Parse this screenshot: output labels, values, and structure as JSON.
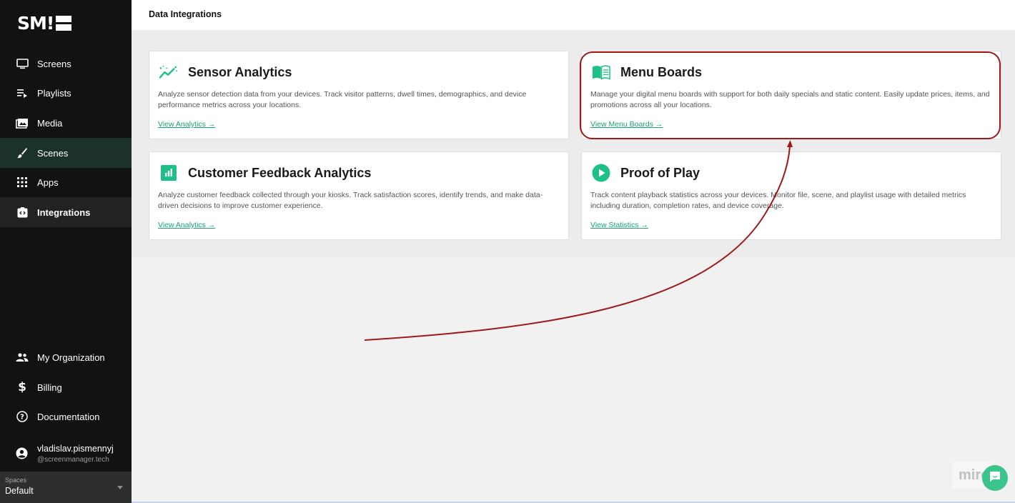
{
  "brand": {
    "logo_text": "SM!"
  },
  "sidebar": {
    "items": [
      {
        "label": "Screens",
        "icon": "monitor-icon"
      },
      {
        "label": "Playlists",
        "icon": "playlist-icon"
      },
      {
        "label": "Media",
        "icon": "media-icon"
      },
      {
        "label": "Scenes",
        "icon": "brush-icon"
      },
      {
        "label": "Apps",
        "icon": "apps-grid-icon"
      },
      {
        "label": "Integrations",
        "icon": "integrations-icon"
      }
    ],
    "bottom_items": [
      {
        "label": "My Organization",
        "icon": "people-icon"
      },
      {
        "label": "Billing",
        "icon": "dollar-icon"
      },
      {
        "label": "Documentation",
        "icon": "help-circle-icon"
      }
    ],
    "user": {
      "name": "vladislav.pismennyj",
      "email": "@screenmanager.tech"
    },
    "spaces": {
      "label": "Spaces",
      "value": "Default"
    }
  },
  "header": {
    "title": "Data Integrations"
  },
  "cards": [
    {
      "title": "Sensor Analytics",
      "description": "Analyze sensor detection data from your devices. Track visitor patterns, dwell times, demographics, and device performance metrics across your locations.",
      "link": "View Analytics →"
    },
    {
      "title": "Menu Boards",
      "description": "Manage your digital menu boards with support for both daily specials and static content. Easily update prices, items, and promotions across all your locations.",
      "link": "View Menu Boards →"
    },
    {
      "title": "Customer Feedback Analytics",
      "description": "Analyze customer feedback collected through your kiosks. Track satisfaction scores, identify trends, and make data-driven decisions to improve customer experience.",
      "link": "View Analytics →"
    },
    {
      "title": "Proof of Play",
      "description": "Track content playback statistics across your devices. Monitor file, scene, and playlist usage with detailed metrics including duration, completion rates, and device coverage.",
      "link": "View Statistics →"
    }
  ],
  "overlay": {
    "watermark": "miro"
  },
  "colors": {
    "accent": "#1aa37a",
    "annotation": "#a01919",
    "sidebar_bg": "#121212"
  }
}
